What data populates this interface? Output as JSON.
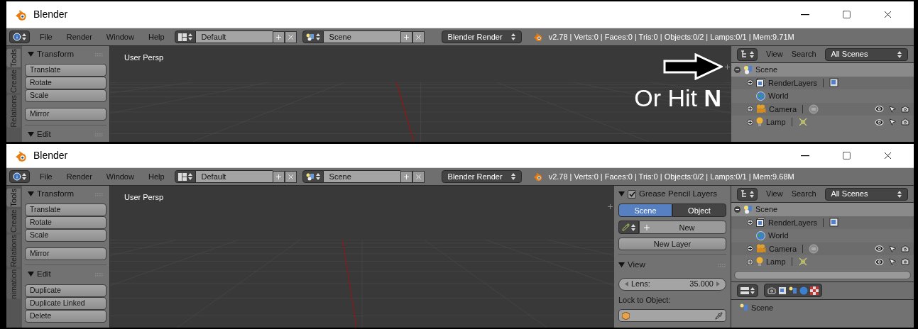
{
  "windows": [
    {
      "title": "Blender",
      "menu": [
        "File",
        "Render",
        "Window",
        "Help"
      ],
      "layout": "Default",
      "scene": "Scene",
      "engine": "Blender Render",
      "stats": "v2.78 | Verts:0 | Faces:0 | Tris:0 | Objects:0/2 | Lamps:0/1 | Mem:9.71M",
      "tool_tabs": [
        {
          "label": "Tools",
          "selected": true
        },
        {
          "label": "Create",
          "selected": false
        },
        {
          "label": "Relations",
          "selected": false
        }
      ],
      "tool_panels": [
        {
          "title": "Transform",
          "expanded": true,
          "groups": [
            [
              "Translate",
              "Rotate",
              "Scale"
            ],
            [
              "Mirror"
            ]
          ]
        },
        {
          "title": "Edit",
          "expanded": true
        }
      ],
      "viewport": {
        "label": "User Persp",
        "hint": "Or Hit **N**"
      },
      "outliner": {
        "view": "View",
        "search": "Search",
        "filter": "All Scenes",
        "tree": [
          {
            "label": "Scene",
            "kind": "scene",
            "expanded": true,
            "selected": true,
            "restrict_icons": false,
            "children": [
              {
                "label": "RenderLayers",
                "kind": "renderlayers",
                "expanded": false,
                "selected": false,
                "restrict_icons": false
              },
              {
                "label": "World",
                "kind": "world",
                "selected": false,
                "restrict_icons": false
              },
              {
                "label": "Camera",
                "kind": "camera",
                "expanded": false,
                "selected": false,
                "restrict_icons": true
              },
              {
                "label": "Lamp",
                "kind": "lamp",
                "expanded": false,
                "selected": false,
                "restrict_icons": true
              }
            ]
          }
        ]
      }
    },
    {
      "title": "Blender",
      "menu": [
        "File",
        "Render",
        "Window",
        "Help"
      ],
      "layout": "Default",
      "scene": "Scene",
      "engine": "Blender Render",
      "stats": "v2.78 | Verts:0 | Faces:0 | Tris:0 | Objects:0/2 | Lamps:0/1 | Mem:9.68M",
      "tool_tabs": [
        {
          "label": "Tools",
          "selected": true
        },
        {
          "label": "Create",
          "selected": false
        },
        {
          "label": "Relations",
          "selected": false
        },
        {
          "label": "nimation",
          "selected": false
        }
      ],
      "tool_panels": [
        {
          "title": "Transform",
          "expanded": true,
          "groups": [
            [
              "Translate",
              "Rotate",
              "Scale"
            ],
            [
              "Mirror"
            ]
          ]
        },
        {
          "title": "Edit",
          "expanded": true,
          "groups": [
            [
              "Duplicate",
              "Duplicate Linked",
              "Delete"
            ]
          ]
        }
      ],
      "viewport": {
        "label": "User Persp"
      },
      "properties_panel": {
        "grease_pencil": {
          "title": "Grease Pencil Layers",
          "checked": true,
          "sources": [
            {
              "label": "Scene",
              "selected": true
            },
            {
              "label": "Object",
              "selected": false
            }
          ],
          "new": "New",
          "new_layer": "New Layer"
        },
        "view": {
          "title": "View",
          "expanded": true,
          "lens_label": "Lens:",
          "lens_value": "35.000",
          "lock_label": "Lock to Object:"
        }
      },
      "outliner": {
        "view": "View",
        "search": "Search",
        "filter": "All Scenes",
        "tree": [
          {
            "label": "Scene",
            "kind": "scene",
            "expanded": true,
            "selected": true,
            "restrict_icons": false,
            "children": [
              {
                "label": "RenderLayers",
                "kind": "renderlayers",
                "expanded": false,
                "selected": false,
                "restrict_icons": false
              },
              {
                "label": "World",
                "kind": "world",
                "selected": false,
                "restrict_icons": false
              },
              {
                "label": "Camera",
                "kind": "camera",
                "expanded": false,
                "selected": false,
                "restrict_icons": true
              },
              {
                "label": "Lamp",
                "kind": "lamp",
                "expanded": false,
                "selected": false,
                "restrict_icons": true
              }
            ]
          }
        ],
        "properties_editor": {
          "context": "Scene"
        }
      }
    }
  ]
}
